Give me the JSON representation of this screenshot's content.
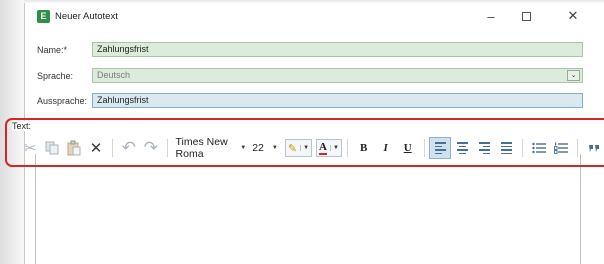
{
  "window": {
    "title": "Neuer Autotext",
    "app_icon_glyph": "E",
    "controls": {
      "minimize": "–",
      "maximize": "",
      "close": "✕"
    }
  },
  "form": {
    "name_label": "Name:*",
    "name_value": "Zahlungsfrist",
    "language_label": "Sprache:",
    "language_value": "Deutsch",
    "language_dropdown_glyph": "⌄",
    "pronunciation_label": "Aussprache:",
    "pronunciation_value": "Zahlungsfrist"
  },
  "text_section": {
    "label": "Text:"
  },
  "toolbar": {
    "font_family": "Times New Roma",
    "font_size": "22",
    "dropdown_arrow": "▼",
    "bold": "B",
    "italic": "I",
    "underline": "U",
    "highlight_color_glyph": "✎",
    "font_color_glyph": "A",
    "cut_glyph": "✂",
    "delete_glyph": "✕",
    "undo_glyph": "↶",
    "redo_glyph": "↷"
  },
  "colors": {
    "accent_green": "#2f8f46",
    "field_bg": "#dcebdc",
    "highlight_border": "#d6262a",
    "font_color_underline": "#d6262a"
  }
}
